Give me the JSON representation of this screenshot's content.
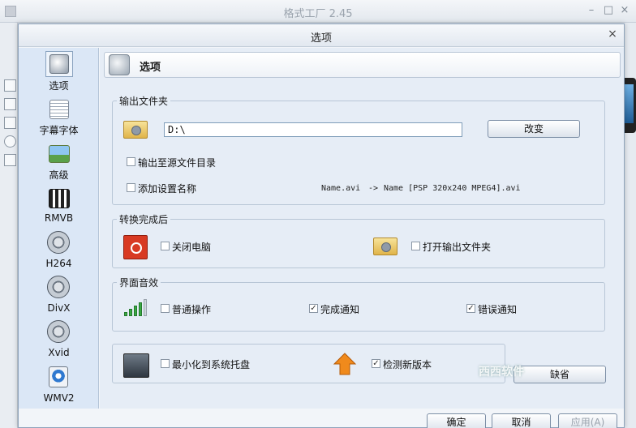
{
  "background_window": {
    "title": "格式工厂 2.45"
  },
  "dialog": {
    "title": "选项",
    "close_glyph": "×"
  },
  "sidebar": {
    "items": [
      {
        "label": "选项",
        "icon": "options-icon"
      },
      {
        "label": "字幕字体",
        "icon": "subtitle-font-icon"
      },
      {
        "label": "高级",
        "icon": "advanced-icon"
      },
      {
        "label": "RMVB",
        "icon": "rmvb-film-icon"
      },
      {
        "label": "H264",
        "icon": "h264-film-icon"
      },
      {
        "label": "DivX",
        "icon": "divx-film-icon"
      },
      {
        "label": "Xvid",
        "icon": "xvid-film-icon"
      },
      {
        "label": "WMV2",
        "icon": "wmv2-icon"
      }
    ]
  },
  "header": {
    "title": "选项"
  },
  "output_folder": {
    "legend": "输出文件夹",
    "path_value": "D:\\",
    "change_button": "改变",
    "to_source_dir_label": "输出至源文件目录",
    "to_source_dir_checked": false,
    "add_setting_name_label": "添加设置名称",
    "add_setting_name_checked": false,
    "example_before": "Name.avi",
    "example_arrow": "->",
    "example_after": "Name [PSP 320x240 MPEG4].avi"
  },
  "after_conversion": {
    "legend": "转换完成后",
    "shutdown_label": "关闭电脑",
    "shutdown_checked": false,
    "open_output_label": "打开输出文件夹",
    "open_output_checked": false
  },
  "sound": {
    "legend": "界面音效",
    "normal_label": "普通操作",
    "normal_checked": false,
    "complete_label": "完成通知",
    "complete_checked": true,
    "error_label": "错误通知",
    "error_checked": true
  },
  "misc": {
    "tray_label": "最小化到系统托盘",
    "tray_checked": false,
    "update_label": "检测新版本",
    "update_checked": true,
    "default_button": "缺省"
  },
  "footer": {
    "ok_button": "确定",
    "cancel_button": "取消",
    "apply_button": "应用(A)"
  },
  "watermark_text": "西西软件",
  "check_glyph": "✓",
  "colors": {
    "sidebar_bg": "#dbe7f6",
    "panel_bg": "#e6edf6",
    "power_red": "#d83a23"
  }
}
